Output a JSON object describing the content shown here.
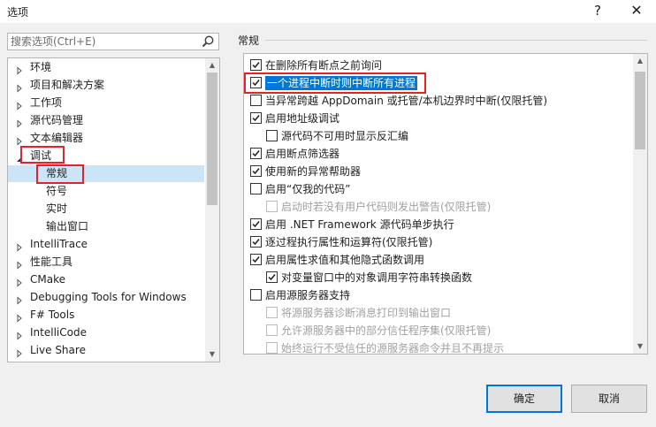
{
  "window": {
    "title": "选项",
    "help_glyph": "?",
    "close_glyph": "✕"
  },
  "search": {
    "placeholder": "搜索选项(Ctrl+E)"
  },
  "tree": {
    "items": [
      {
        "label": "环境",
        "expanded": false,
        "level": 0
      },
      {
        "label": "项目和解决方案",
        "expanded": false,
        "level": 0
      },
      {
        "label": "工作项",
        "expanded": false,
        "level": 0
      },
      {
        "label": "源代码管理",
        "expanded": false,
        "level": 0
      },
      {
        "label": "文本编辑器",
        "expanded": false,
        "level": 0
      },
      {
        "label": "调试",
        "expanded": true,
        "level": 0
      },
      {
        "label": "常规",
        "level": 1,
        "selected": true
      },
      {
        "label": "符号",
        "level": 1
      },
      {
        "label": "实时",
        "level": 1
      },
      {
        "label": "输出窗口",
        "level": 1
      },
      {
        "label": "IntelliTrace",
        "expanded": false,
        "level": 0
      },
      {
        "label": "性能工具",
        "expanded": false,
        "level": 0
      },
      {
        "label": "CMake",
        "expanded": false,
        "level": 0
      },
      {
        "label": "Debugging Tools for Windows",
        "expanded": false,
        "level": 0
      },
      {
        "label": "F# Tools",
        "expanded": false,
        "level": 0
      },
      {
        "label": "IntelliCode",
        "expanded": false,
        "level": 0
      },
      {
        "label": "Live Share",
        "expanded": false,
        "level": 0
      }
    ]
  },
  "section": {
    "title": "常规"
  },
  "options": [
    {
      "label": "在删除所有断点之前询问",
      "checked": true,
      "enabled": true,
      "indent": 0
    },
    {
      "label": "一个进程中断时则中断所有进程",
      "checked": true,
      "enabled": true,
      "indent": 0,
      "selected": true
    },
    {
      "label": "当异常跨越 AppDomain 或托管/本机边界时中断(仅限托管)",
      "checked": false,
      "enabled": true,
      "indent": 0
    },
    {
      "label": "启用地址级调试",
      "checked": true,
      "enabled": true,
      "indent": 0
    },
    {
      "label": "源代码不可用时显示反汇编",
      "checked": false,
      "enabled": true,
      "indent": 1
    },
    {
      "label": "启用断点筛选器",
      "checked": true,
      "enabled": true,
      "indent": 0
    },
    {
      "label": "使用新的异常帮助器",
      "checked": true,
      "enabled": true,
      "indent": 0
    },
    {
      "label": "启用“仅我的代码”",
      "checked": false,
      "enabled": true,
      "indent": 0
    },
    {
      "label": "启动时若没有用户代码则发出警告(仅限托管)",
      "checked": false,
      "enabled": false,
      "indent": 1
    },
    {
      "label": "启用 .NET Framework 源代码单步执行",
      "checked": true,
      "enabled": true,
      "indent": 0
    },
    {
      "label": "逐过程执行属性和运算符(仅限托管)",
      "checked": true,
      "enabled": true,
      "indent": 0
    },
    {
      "label": "启用属性求值和其他隐式函数调用",
      "checked": true,
      "enabled": true,
      "indent": 0
    },
    {
      "label": "对变量窗口中的对象调用字符串转换函数",
      "checked": true,
      "enabled": true,
      "indent": 1
    },
    {
      "label": "启用源服务器支持",
      "checked": false,
      "enabled": true,
      "indent": 0
    },
    {
      "label": "将源服务器诊断消息打印到输出窗口",
      "checked": false,
      "enabled": false,
      "indent": 1
    },
    {
      "label": "允许源服务器中的部分信任程序集(仅限托管)",
      "checked": false,
      "enabled": false,
      "indent": 1
    },
    {
      "label": "始终运行不受信任的源服务器命令并且不再提示",
      "checked": false,
      "enabled": false,
      "indent": 1
    }
  ],
  "buttons": {
    "ok": "确定",
    "cancel": "取消"
  },
  "colors": {
    "highlight": "#e8202a",
    "accent": "#0078d7",
    "selection": "#cce4f7"
  }
}
